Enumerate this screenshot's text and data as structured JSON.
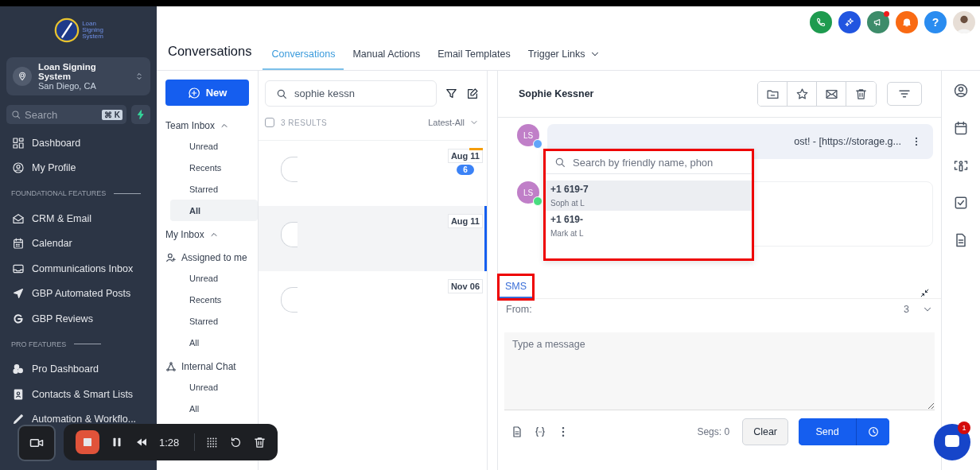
{
  "sidebar": {
    "logo_text": [
      "Loan",
      "Signing",
      "System"
    ],
    "account": {
      "name": "Loan Signing System",
      "location": "San Diego, CA"
    },
    "search": {
      "placeholder": "Search",
      "shortcut": "⌘ K"
    },
    "sections": [
      {
        "items": [
          {
            "label": "Dashboard"
          },
          {
            "label": "My Profile"
          }
        ]
      },
      {
        "title": "FOUNDATIONAL FEATURES",
        "items": [
          {
            "label": "CRM & Email"
          },
          {
            "label": "Calendar"
          },
          {
            "label": "Communications Inbox"
          },
          {
            "label": "GBP Automated Posts"
          },
          {
            "label": "GBP Reviews"
          }
        ]
      },
      {
        "title": "PRO FEATURES",
        "items": [
          {
            "label": "Pro Dashboard"
          },
          {
            "label": "Contacts & Smart Lists"
          },
          {
            "label": "Automation & Workflo..."
          }
        ]
      }
    ]
  },
  "topbar": {
    "megaphone_unread": true,
    "help_label": "?"
  },
  "header": {
    "title": "Conversations",
    "tabs": [
      {
        "label": "Conversations",
        "selected": true,
        "has_menu": false
      },
      {
        "label": "Manual Actions",
        "selected": false,
        "has_menu": false
      },
      {
        "label": "Email Templates",
        "selected": false,
        "has_menu": false
      },
      {
        "label": "Trigger Links",
        "selected": false,
        "has_menu": true
      }
    ]
  },
  "inbox_nav": {
    "new_button": "New",
    "groups": [
      {
        "kind": "section",
        "title": "Team Inbox",
        "expanded": true,
        "items": [
          {
            "label": "Unread",
            "selected": false
          },
          {
            "label": "Recents",
            "selected": false
          },
          {
            "label": "Starred",
            "selected": false
          },
          {
            "label": "All",
            "selected": true
          }
        ]
      },
      {
        "kind": "section",
        "title": "My Inbox",
        "expanded": true
      },
      {
        "kind": "channel",
        "title": "Assigned to me",
        "items": [
          {
            "label": "Unread",
            "selected": false
          },
          {
            "label": "Recents",
            "selected": false
          },
          {
            "label": "Starred",
            "selected": false
          },
          {
            "label": "All",
            "selected": false
          }
        ]
      },
      {
        "kind": "channel",
        "title": "Internal Chat",
        "items": [
          {
            "label": "Unread",
            "selected": false
          },
          {
            "label": "All",
            "selected": false
          }
        ]
      }
    ]
  },
  "list": {
    "search_value": "sophie kessn",
    "select_all": false,
    "results": "3 RESULTS",
    "sort": "Latest-All",
    "rows": [
      {
        "date": "Aug 11",
        "unread": "6",
        "marked": true,
        "selected": false
      },
      {
        "date": "Aug 11",
        "marked": false,
        "selected": true
      },
      {
        "date": "Nov 06",
        "marked": false,
        "selected": false
      }
    ]
  },
  "conversation": {
    "contact": "Sophie Kessner",
    "messages": [
      {
        "initials": "LS",
        "kind": "email",
        "text": "ost!  -  [https://storage.g..."
      },
      {
        "initials": "LS",
        "kind": "sms"
      }
    ]
  },
  "picker": {
    "highlighted": true,
    "placeholder": "Search by friendly name, phon",
    "options": [
      {
        "number": "+1 619-7",
        "name": "Soph at L",
        "selected": true
      },
      {
        "number": "+1 619-",
        "name": "Mark at L",
        "selected": false
      }
    ]
  },
  "composer": {
    "tabs": [
      {
        "label": "SMS",
        "selected": true,
        "highlighted": true
      }
    ],
    "from_label": "From:",
    "from_value": "3",
    "placeholder": "Type a message",
    "segments": "Segs: 0",
    "clear": "Clear",
    "send": "Send"
  },
  "chat_widget": {
    "badge": "1"
  },
  "recorder": {
    "time": "1:28"
  }
}
